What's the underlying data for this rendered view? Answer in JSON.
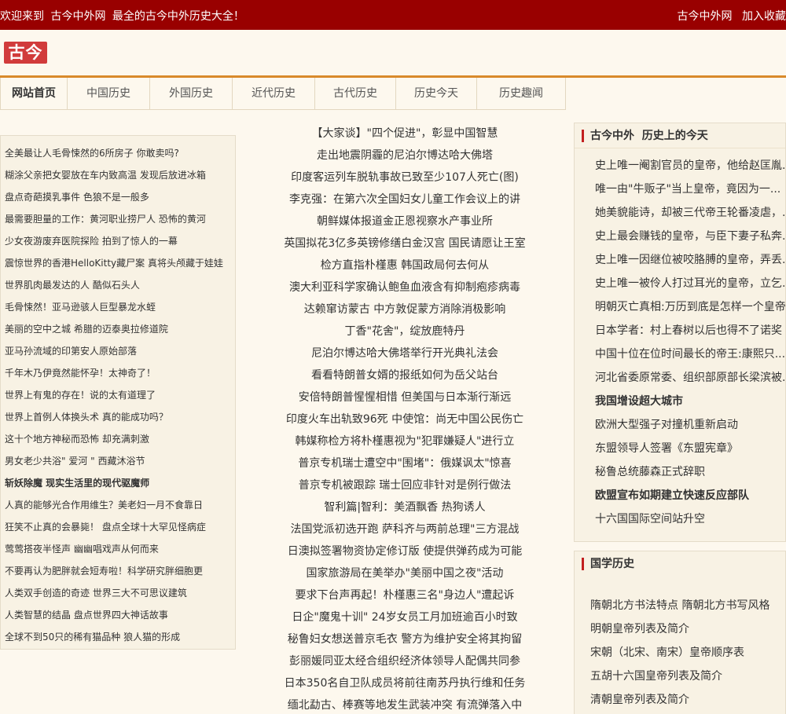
{
  "topbar": {
    "welcome": [
      "欢迎来到",
      "古今中外网",
      "最全的古今中外历史大全！"
    ],
    "links": [
      "古今中外网",
      "加入收藏"
    ]
  },
  "logo": "古今",
  "nav": [
    "网站首页",
    "中国历史",
    "外国历史",
    "近代历史",
    "古代历史",
    "历史今天",
    "历史趣闻"
  ],
  "left_list": [
    "全美最让人毛骨悚然的6所房子  你敢卖吗?",
    "糊涂父亲把女婴放在车内致高温  发现后放进冰箱",
    "盘点奇葩摸乳事件  色狼不是一般多",
    "最需要胆量的工作：黄河职业捞尸人  恐怖的黄河",
    "少女夜游废弃医院探险  拍到了惊人的一幕",
    "震惊世界的香港HelloKitty藏尸案  真将头颅藏于娃娃",
    "世界肌肉最发达的人  酷似石头人",
    "毛骨悚然！亚马逊骇人巨型暴龙水蛭",
    "美丽的空中之城  希腊的迈泰奥拉修道院",
    "亚马孙流域的印第安人原始部落",
    "千年木乃伊竟然能怀孕！太神奇了！",
    "世界上有鬼的存在！说的太有道理了",
    "世界上首例人体换头术  真的能成功吗？",
    "这十个地方神秘而恐怖  却充满刺激",
    "男女老少共浴\" 爱河 \"  西藏沐浴节",
    "斩妖除魔  现实生活里的现代驱魔师",
    "人真的能够光合作用维生？美老妇一月不食靠日",
    "狂笑不止真的会暴毙！  盘点全球十大罕见怪病症",
    "莺莺搭夜半怪声  幽幽唱戏声从何而来",
    "不要再认为肥胖就会短寿啦！科学研究胖细胞更",
    "人类双手创造的奇迹  世界三大不可思议建筑",
    "人类智慧的结晶  盘点世界四大神话故事",
    "全球不到50只的稀有猫品种  狼人猫的形成"
  ],
  "left_bold_index": 15,
  "center_list": [
    "【大家谈】\"四个促进\"，彰显中国智慧",
    "走出地震阴霾的尼泊尔博达哈大佛塔",
    "印度客运列车脱轨事故已致至少107人死亡(图)",
    "李克强：在第六次全国妇女儿童工作会议上的讲",
    "朝鲜媒体报道金正恩视察水产事业所",
    "英国拟花3亿多英镑修缮白金汉宫  国民请愿让王室",
    "检方直指朴槿惠  韩国政局何去何从",
    "澳大利亚科学家确认鲍鱼血液含有抑制疱疹病毒",
    "达赖窜访蒙古  中方敦促蒙方消除消极影响",
    "丁香\"花舍\"，绽放鹿特丹",
    "尼泊尔博达哈大佛塔举行开光典礼法会",
    "看看特朗普女婿的报纸如何为岳父站台",
    "安倍特朗普惺惺相惜  但美国与日本渐行渐远",
    "印度火车出轨致96死  中使馆：尚无中国公民伤亡",
    "韩媒称检方将朴槿惠视为\"犯罪嫌疑人\"进行立",
    "普京专机瑞士遭空中\"围堵\"：俄媒讽太\"惊喜",
    "普京专机被跟踪  瑞士回应非针对是例行做法",
    "智利篇|智利：美酒飘香  热狗诱人",
    "法国党派初选开跑  萨科齐与两前总理\"三方混战",
    "日澳拟签署物资协定修订版  使提供弹药成为可能",
    "国家旅游局在美举办\"美丽中国之夜\"活动",
    "要求下台声再起！朴槿惠三名\"身边人\"遭起诉",
    "日企\"魔鬼十训\"  24岁女员工月加班逾百小时致",
    "秘鲁妇女想送普京毛衣  警方为维护安全将其拘留",
    "彭丽媛同亚太经合组织经济体领导人配偶共同参",
    "日本350名自卫队成员将前往南苏丹执行维和任务",
    "缅北勐古、棒赛等地发生武装冲突  有流弹落入中"
  ],
  "box1": {
    "title_part1": "古今中外",
    "title_part2": "历史上的今天",
    "items": [
      "史上唯一阉割官员的皇帝，他给赵匡胤...",
      "唯一由\"牛贩子\"当上皇帝，竟因为一...",
      "她美貌能诗，却被三代帝王轮番凌虐，...",
      "史上最会赚钱的皇帝，与臣下妻子私奔...",
      "史上唯一因继位被咬胳膊的皇帝，弄丢...",
      "史上唯一被伶人打过耳光的皇帝，立乞...",
      "明朝灭亡真相:万历到底是怎样一个皇帝",
      "日本学者：村上春树以后也得不了诺奖",
      "中国十位在位时间最长的帝王:康熙只...",
      "河北省委原常委、组织部原部长梁滨被...",
      "我国增设超大城市",
      "欧洲大型强子对撞机重新启动",
      "东盟领导人签署《东盟宪章》",
      "秘鲁总统藤森正式辞职",
      "欧盟宣布如期建立快速反应部队",
      "十六国国际空间站升空"
    ],
    "bold_indices": [
      10,
      14
    ]
  },
  "box2": {
    "title": "国学历史",
    "items": [
      "隋朝北方书法特点  隋朝北方书写风格",
      "明朝皇帝列表及简介",
      "宋朝（北宋、南宋）皇帝顺序表",
      "五胡十六国皇帝列表及简介",
      "清朝皇帝列表及简介"
    ]
  },
  "colors": {
    "topbar": "#990000",
    "accent_line": "#d98a2b",
    "logo_bg": "#d13b3b",
    "page_bg": "#fdf8ee",
    "heading_bar": "#c21f1f"
  }
}
